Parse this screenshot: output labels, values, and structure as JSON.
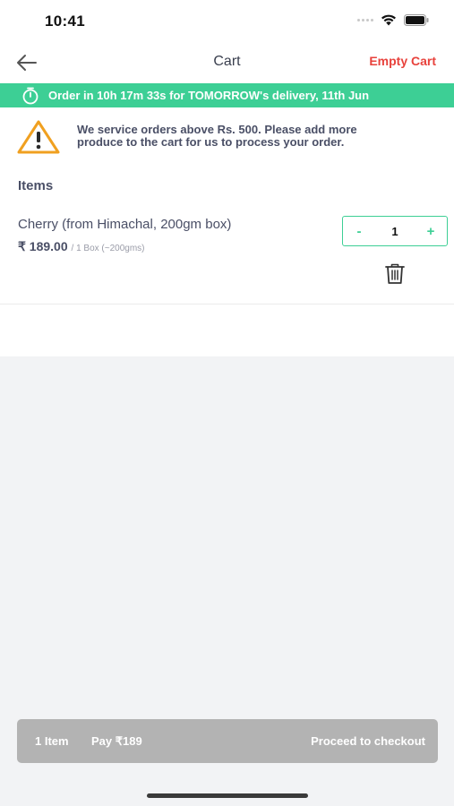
{
  "status_bar": {
    "time": "10:41"
  },
  "nav": {
    "title": "Cart",
    "empty_cart": "Empty Cart"
  },
  "banner": {
    "text": "Order in 10h 17m 33s for TOMORROW's delivery, 11th Jun",
    "color": "#3dcf95"
  },
  "notice": {
    "line1": "We service orders above Rs. 500. Please add more",
    "line2": "produce to the cart for us to process your order."
  },
  "items_heading": "Items",
  "items": [
    {
      "name": "Cherry (from Himachal, 200gm box)",
      "price": "₹ 189.00",
      "unit": "/ 1 Box (~200gms)",
      "quantity": "1",
      "minus": "-",
      "plus": "+"
    }
  ],
  "checkout": {
    "count": "1 Item",
    "pay": "Pay ₹189",
    "proceed": "Proceed to checkout"
  },
  "colors": {
    "accent": "#3dcf95",
    "danger": "#e8423c",
    "warning": "#f0a020"
  }
}
